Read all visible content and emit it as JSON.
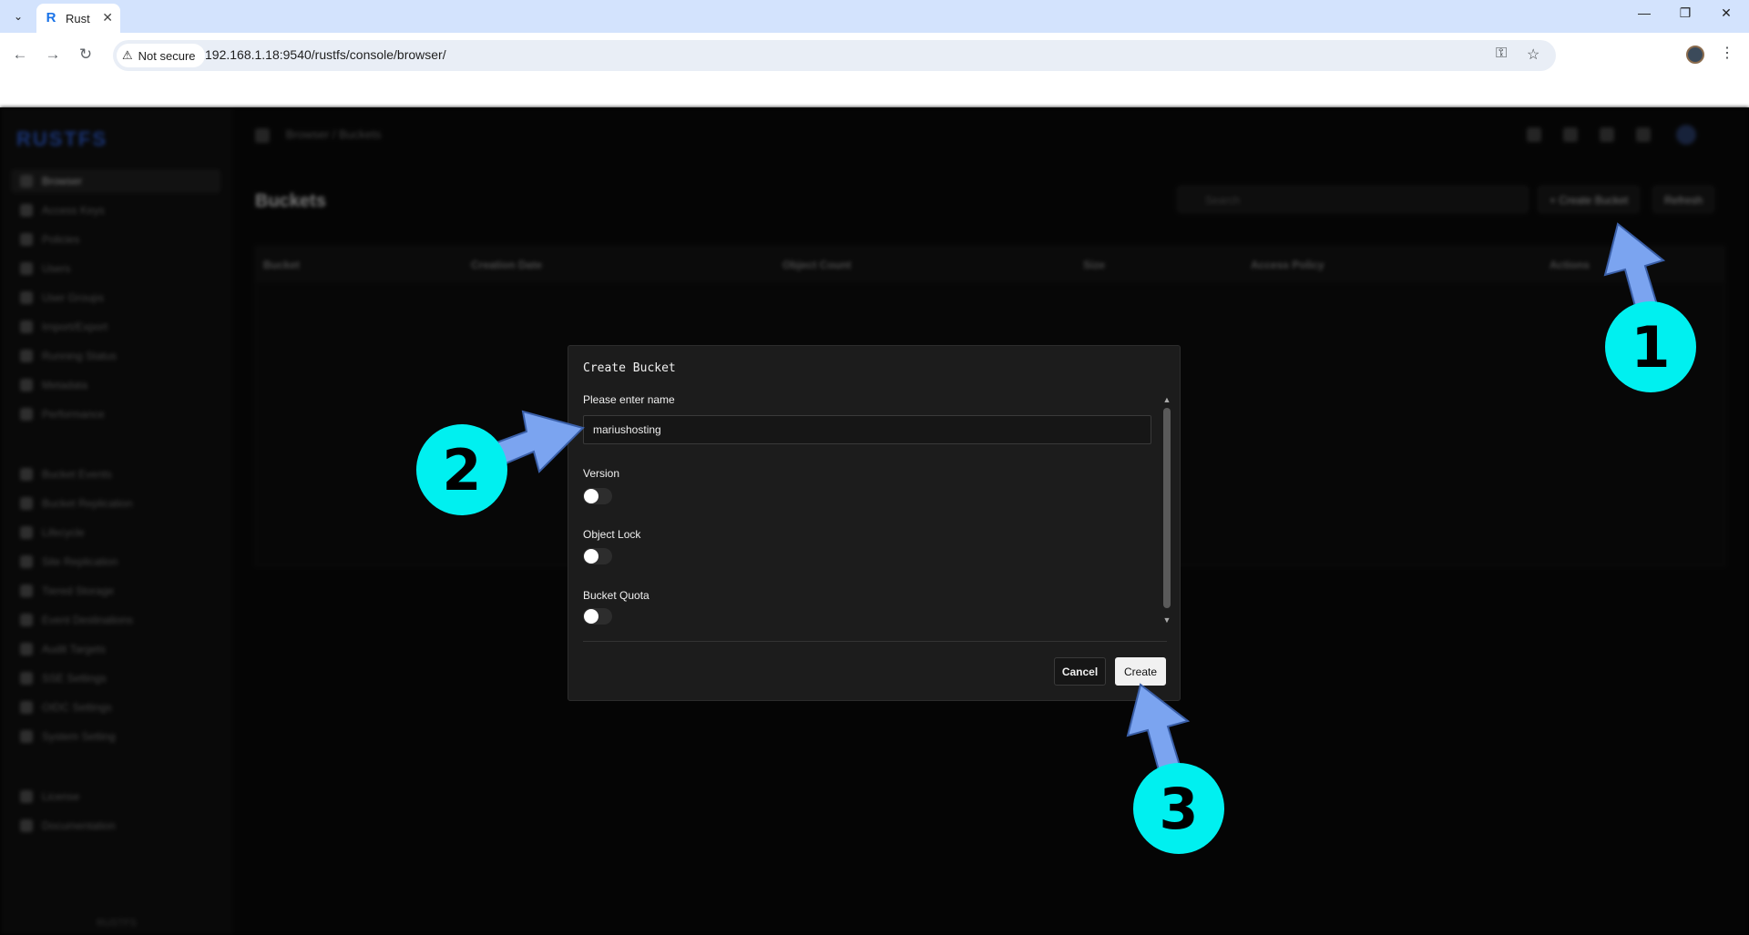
{
  "browser": {
    "tab_title": "Rust",
    "tab_favicon": "R",
    "security_label": "Not secure",
    "url": "192.168.1.18:9540/rustfs/console/browser/"
  },
  "app": {
    "logo": "RUSTFS",
    "sidebar": {
      "items": [
        "Browser",
        "Access Keys",
        "Policies",
        "Users",
        "User Groups",
        "Import/Export",
        "Running Status",
        "Metadata",
        "Performance",
        "Bucket Events",
        "Bucket Replication",
        "Lifecycle",
        "Site Replication",
        "Tiered Storage",
        "Event Destinations",
        "Audit Targets",
        "SSE Settings",
        "OIDC Settings",
        "System Setting",
        "License",
        "Documentation"
      ],
      "version": "RUSTFS"
    },
    "breadcrumb": "Browser  /  Buckets",
    "page_title": "Buckets",
    "search_placeholder": "Search",
    "create_bucket_label": "+ Create Bucket",
    "refresh_label": "Refresh",
    "columns": [
      "Bucket",
      "Creation Date",
      "Object Count",
      "Size",
      "Access Policy",
      "Actions"
    ]
  },
  "modal": {
    "title": "Create Bucket",
    "name_label": "Please enter name",
    "name_value": "mariushosting",
    "version_label": "Version",
    "object_lock_label": "Object Lock",
    "bucket_quota_label": "Bucket Quota",
    "cancel_label": "Cancel",
    "create_label": "Create",
    "toggles": {
      "version": false,
      "object_lock": false,
      "bucket_quota": false
    }
  },
  "annotations": {
    "steps": [
      "1",
      "2",
      "3"
    ],
    "circle_color": "#00f0f0",
    "arrow_color": "#7ba4f0"
  }
}
